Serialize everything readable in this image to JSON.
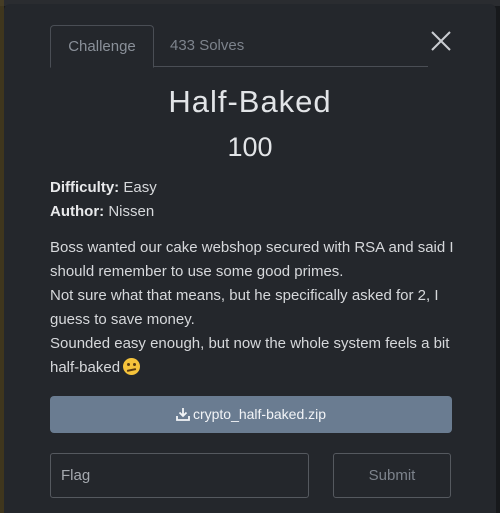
{
  "tabs": [
    {
      "label": "Challenge",
      "active": true
    },
    {
      "label": "433 Solves",
      "active": false
    }
  ],
  "challenge": {
    "name": "Half-Baked",
    "value": "100",
    "difficulty_label": "Difficulty:",
    "difficulty": "Easy",
    "author_label": "Author:",
    "author": "Nissen",
    "description": [
      "Boss wanted our cake webshop secured with RSA and said I should remember to use some good primes.",
      "Not sure what that means, but he specifically asked for 2, I guess to save money.",
      "Sounded easy enough, but now the whole system feels a bit half-baked"
    ],
    "emoji": "confused-face"
  },
  "file": {
    "name": "crypto_half-baked.zip",
    "icon": "download-icon"
  },
  "form": {
    "flag_placeholder": "Flag",
    "flag_value": "",
    "submit_label": "Submit"
  },
  "colors": {
    "modal_bg": "#24272c",
    "download_bg": "#6a7c91",
    "border": "#55595f"
  }
}
